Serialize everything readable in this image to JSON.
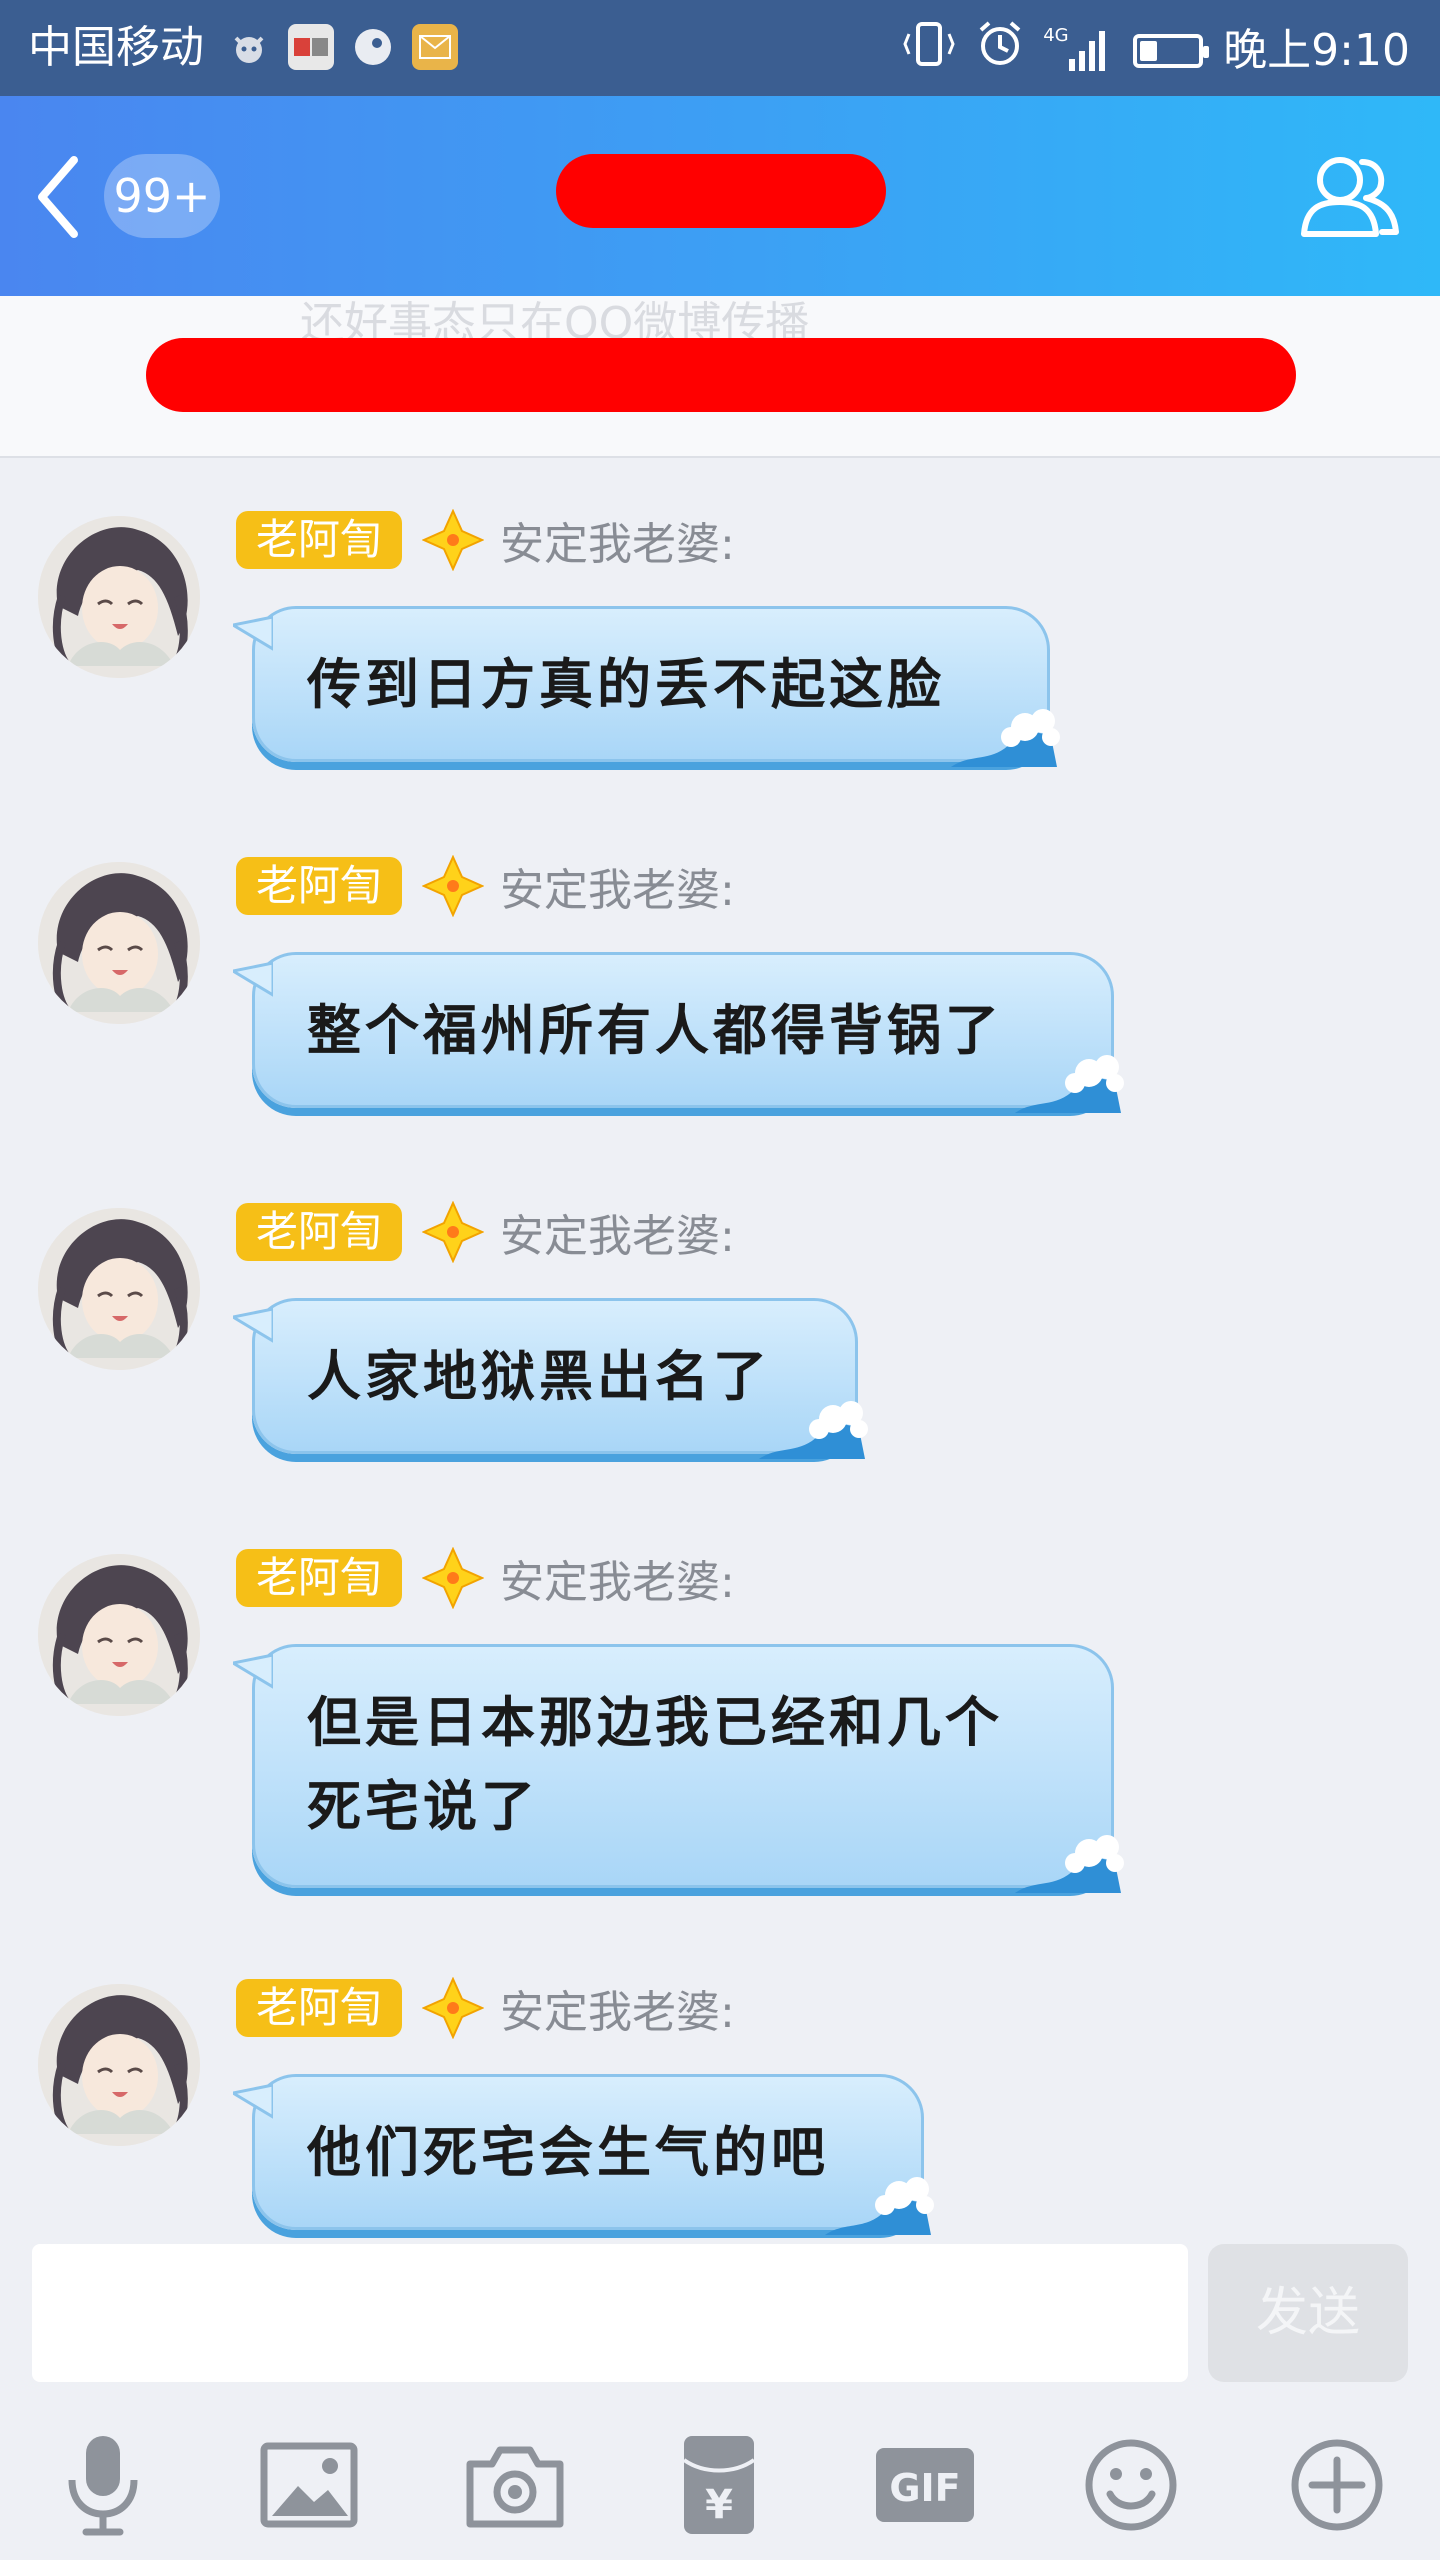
{
  "status_bar": {
    "carrier": "中国移动",
    "network": "4G",
    "time": "晚上9:10",
    "battery_level": 0.3
  },
  "header": {
    "unread_count": "99+",
    "back_icon": "chevron-left-icon",
    "profile_icon": "group-profile-icon"
  },
  "notice": {
    "partial_text": "还好事态只在QQ微博传播"
  },
  "messages": [
    {
      "tag": "老阿訇",
      "nick": "安定我老婆:",
      "text": "传到日方真的丢不起这脸"
    },
    {
      "tag": "老阿訇",
      "nick": "安定我老婆:",
      "text": "整个福州所有人都得背锅了"
    },
    {
      "tag": "老阿訇",
      "nick": "安定我老婆:",
      "text": "人家地狱黑出名了"
    },
    {
      "tag": "老阿訇",
      "nick": "安定我老婆:",
      "text": "但是日本那边我已经和几个死宅说了"
    },
    {
      "tag": "老阿訇",
      "nick": "安定我老婆:",
      "text": "他们死宅会生气的吧"
    }
  ],
  "input": {
    "value": "",
    "send_label": "发送"
  },
  "toolbar": {
    "items": [
      "microphone-icon",
      "image-icon",
      "camera-icon",
      "red-packet-icon",
      "gif-icon",
      "emoji-icon",
      "plus-icon"
    ],
    "gif_label": "GIF",
    "red_packet_symbol": "¥"
  },
  "colors": {
    "status_bar": "#3b5e91",
    "header_start": "#4a86f0",
    "header_end": "#2fb8f8",
    "tag": "#f6bf17",
    "redaction": "#ff0000"
  }
}
